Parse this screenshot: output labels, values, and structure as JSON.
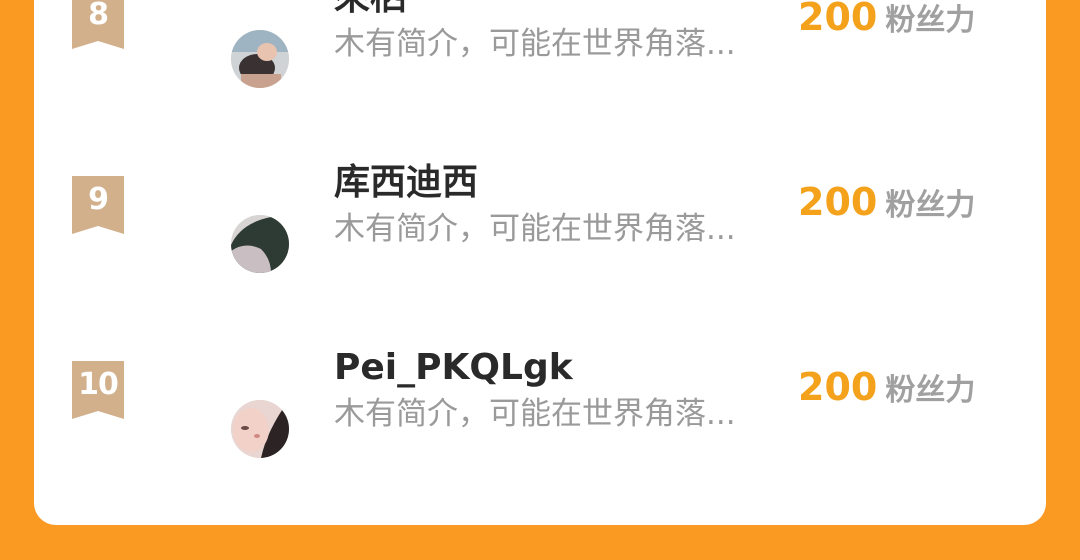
{
  "colors": {
    "background": "#fb9a23",
    "card": "#ffffff",
    "badge": "#d2b08c",
    "fans_count": "#f4a21c",
    "name": "#2a2a2a",
    "bio": "#9a9a9a"
  },
  "leaderboard": {
    "rows": [
      {
        "rank": "8",
        "name": "來栖",
        "bio": "木有简介，可能在世界角落...",
        "fans_count": "200",
        "fans_unit": "粉丝力"
      },
      {
        "rank": "9",
        "name": "库西迪西",
        "bio": "木有简介，可能在世界角落...",
        "fans_count": "200",
        "fans_unit": "粉丝力"
      },
      {
        "rank": "10",
        "name": "Pei_PKQLgk",
        "bio": "木有简介，可能在世界角落...",
        "fans_count": "200",
        "fans_unit": "粉丝力"
      }
    ]
  }
}
